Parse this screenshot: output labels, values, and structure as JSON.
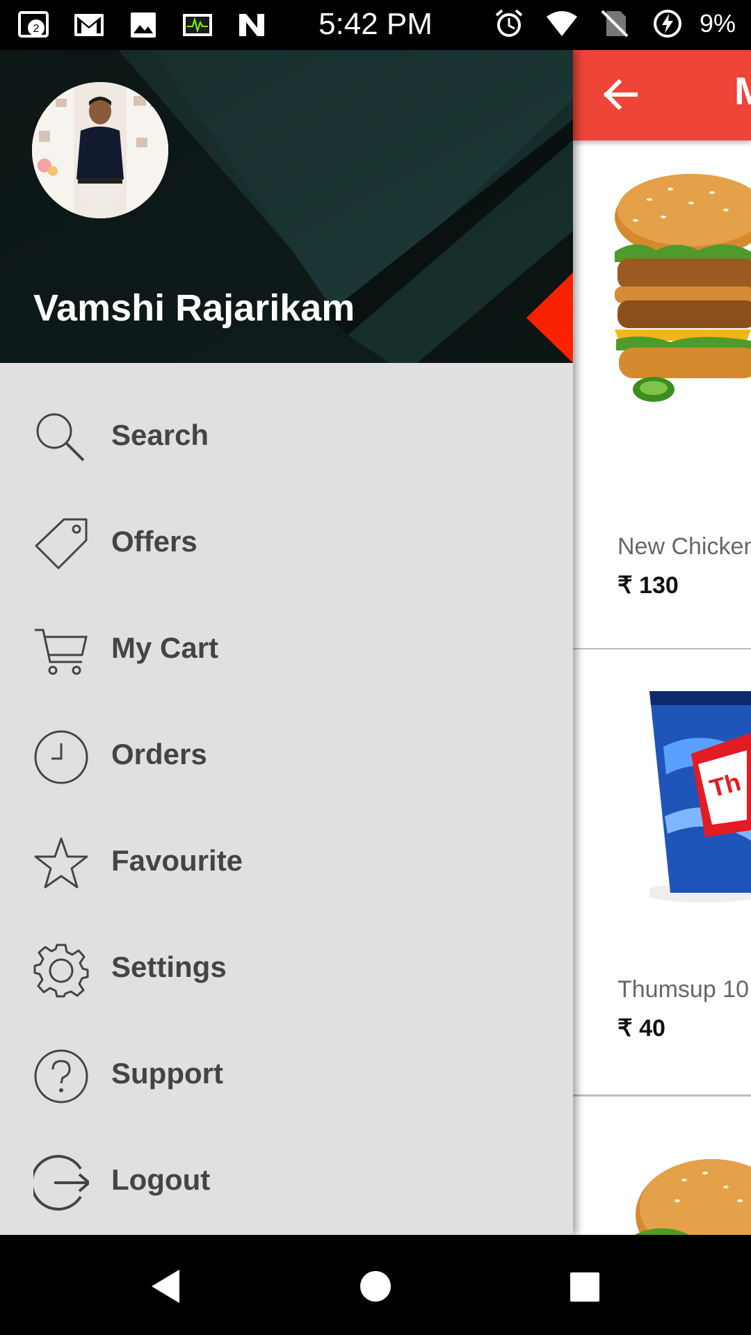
{
  "status_bar": {
    "time": "5:42 PM",
    "notification_badge": "2",
    "battery": "9%",
    "icons": [
      "notification-badge-icon",
      "gmail-icon",
      "image-icon",
      "activity-monitor-icon",
      "n-icon",
      "alarm-icon",
      "wifi-icon",
      "no-sim-icon",
      "battery-charging-icon"
    ]
  },
  "drawer": {
    "user_name": "Vamshi Rajarikam",
    "items": [
      {
        "label": "Search",
        "icon": "search-icon"
      },
      {
        "label": "Offers",
        "icon": "tag-icon"
      },
      {
        "label": "My Cart",
        "icon": "cart-icon"
      },
      {
        "label": "Orders",
        "icon": "clock-icon"
      },
      {
        "label": "Favourite",
        "icon": "star-icon"
      },
      {
        "label": "Settings",
        "icon": "gear-icon"
      },
      {
        "label": "Support",
        "icon": "help-icon"
      },
      {
        "label": "Logout",
        "icon": "logout-icon"
      }
    ]
  },
  "content": {
    "appbar_title_partial": "M",
    "products": [
      {
        "name": "New Chicken",
        "price": "₹ 130",
        "image": "burger-image"
      },
      {
        "name": "Thumsup 10",
        "price": "₹ 40",
        "image": "cup-image"
      },
      {
        "name": "",
        "price": "",
        "image": "burger-image"
      }
    ]
  },
  "colors": {
    "accent": "#EF4538",
    "drawer_bg": "#E0E0E0",
    "header_bg": "#13201F",
    "text": "#444444"
  },
  "nav_bar": {
    "buttons": [
      "back-button",
      "home-button",
      "recents-button"
    ]
  }
}
